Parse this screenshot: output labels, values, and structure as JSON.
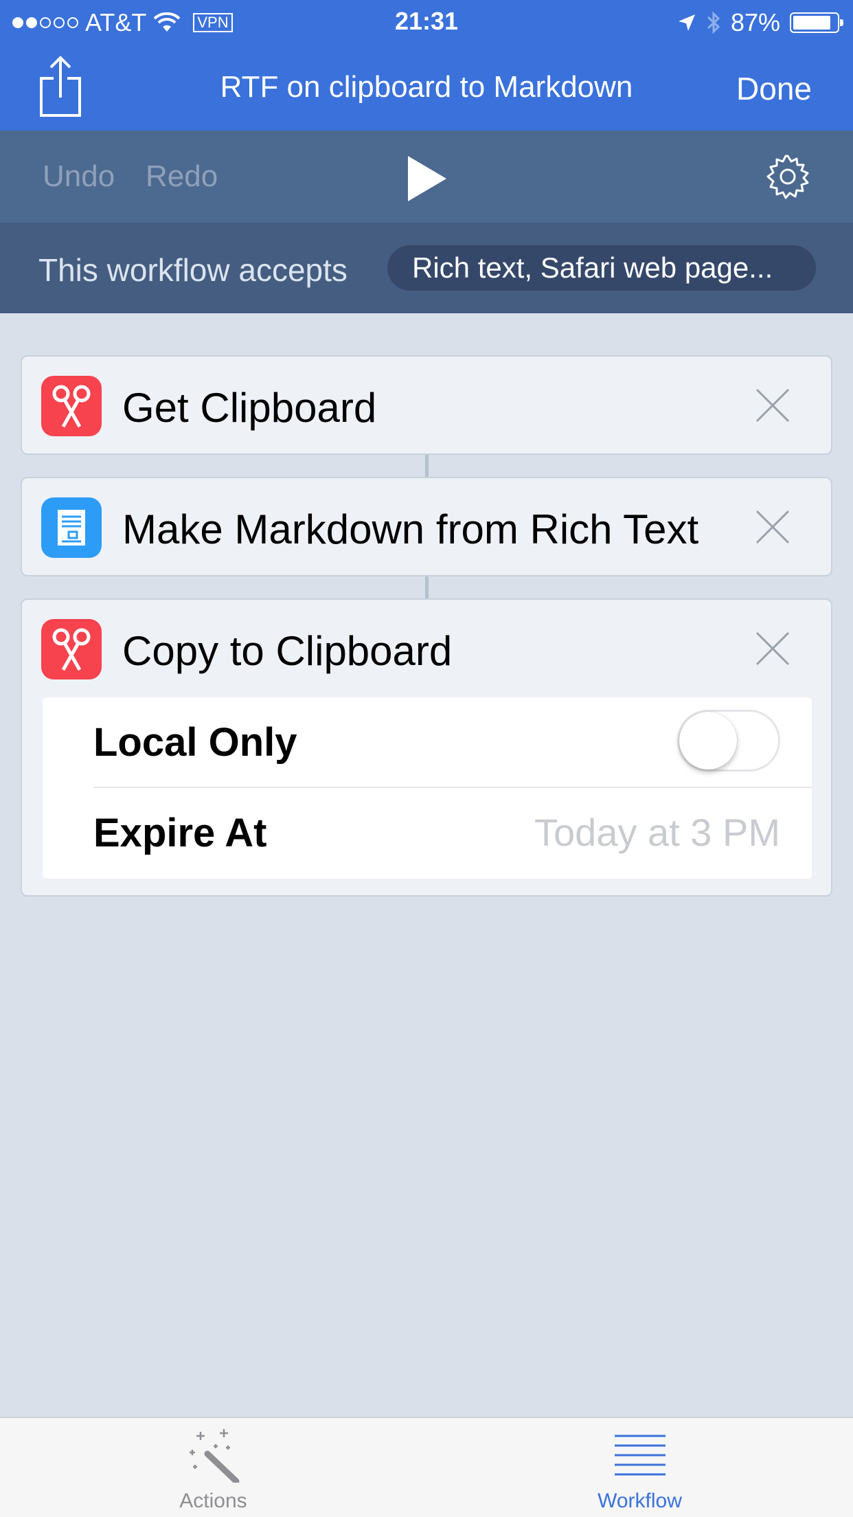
{
  "status_bar": {
    "carrier": "AT&T",
    "vpn": "VPN",
    "time": "21:31",
    "battery": "87%",
    "battery_level": 0.87
  },
  "nav": {
    "title": "RTF on clipboard to Markdown",
    "done_label": "Done"
  },
  "toolbar": {
    "undo_label": "Undo",
    "redo_label": "Redo"
  },
  "accepts": {
    "label": "This workflow accepts",
    "types": "Rich text, Safari web page..."
  },
  "actions": [
    {
      "title": "Get Clipboard",
      "icon": "scissors-icon",
      "color": "#f6434e"
    },
    {
      "title": "Make Markdown from Rich Text",
      "icon": "document-icon",
      "color": "#2d9cf6"
    },
    {
      "title": "Copy to Clipboard",
      "icon": "scissors-icon",
      "color": "#f6434e",
      "settings": {
        "local_only_label": "Local Only",
        "local_only_value": false,
        "expire_label": "Expire At",
        "expire_placeholder": "Today at 3 PM"
      }
    }
  ],
  "tabs": [
    {
      "label": "Actions",
      "icon": "magic-wand-icon",
      "active": false
    },
    {
      "label": "Workflow",
      "icon": "list-icon",
      "active": true
    }
  ],
  "colors": {
    "accent": "#3a71db",
    "toolbar": "#4c6990",
    "accepts_bar": "#445d80",
    "background": "#d9e0ea"
  }
}
